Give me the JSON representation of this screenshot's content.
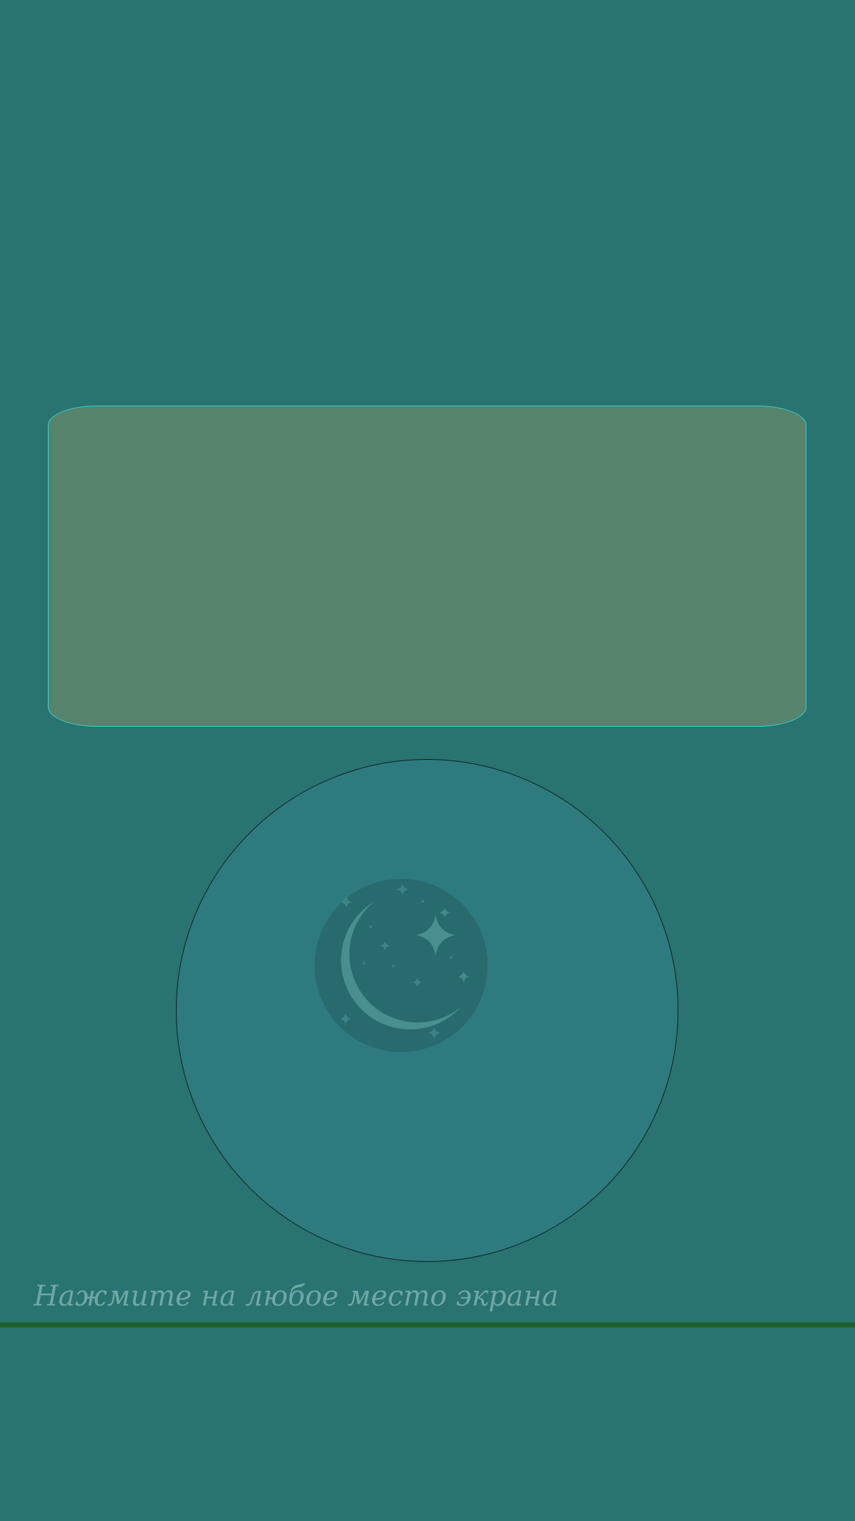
{
  "screen": {
    "background_color": "#297370",
    "hint_text": "Нажмите на любое место экрана"
  },
  "panel": {
    "fill_color": "#55836b",
    "border_color": "#3ed2d6"
  },
  "circle_button": {
    "fill_color": "#2d7b7f",
    "icon": "moon-stars-icon"
  },
  "divider": {
    "color": "#1d5f2c"
  }
}
